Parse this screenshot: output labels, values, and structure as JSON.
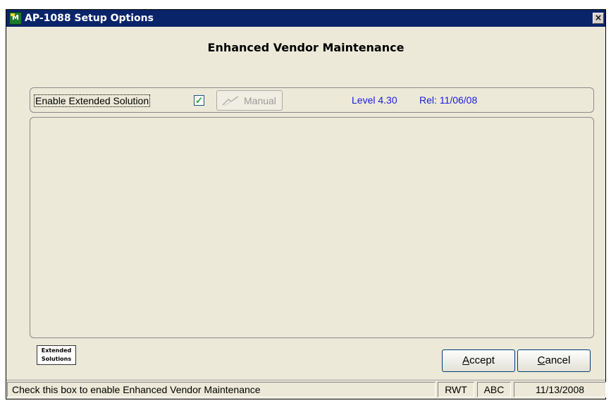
{
  "window": {
    "title": "AP-1088 Setup Options",
    "close_glyph": "×",
    "app_icon": "app-icon"
  },
  "heading": "Enhanced Vendor Maintenance",
  "options": {
    "enable_label": "Enable Extended Solution",
    "enable_checked": true,
    "checkbox_glyph": "✓",
    "manual_label": "Manual",
    "level": "Level 4.30",
    "release": "Rel: 11/06/08"
  },
  "logo": {
    "line1": "Extended",
    "line2": "Solutions"
  },
  "buttons": {
    "accept": "Accept",
    "cancel": "Cancel"
  },
  "statusbar": {
    "message": "Check this box to enable Enhanced Vendor Maintenance",
    "user": "RWT",
    "company": "ABC",
    "date": "11/13/2008"
  },
  "colors": {
    "titlebar": "#0a246a",
    "dialog_bg": "#ece9d8",
    "version_text": "#1b1bdc",
    "checkmark": "#21a121"
  }
}
